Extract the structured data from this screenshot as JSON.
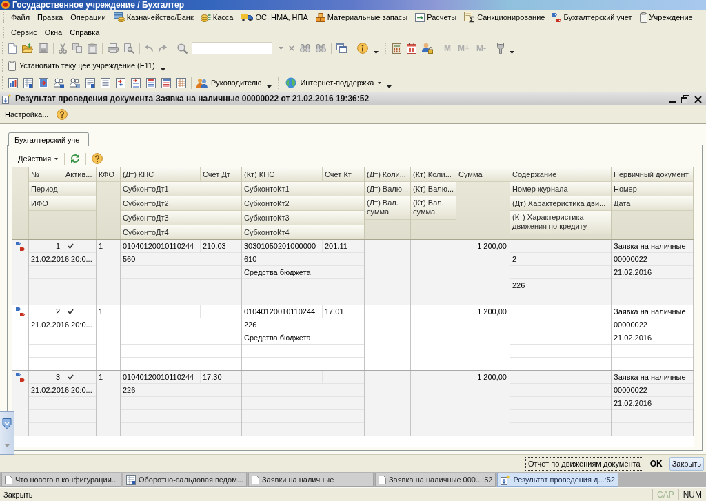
{
  "app_window": {
    "title": "Государственное учреждение / Бухгалтер"
  },
  "menu_bar": {
    "rows": [
      {
        "items": [
          {
            "label": "Файл"
          },
          {
            "label": "Правка"
          },
          {
            "label": "Операции"
          },
          {
            "label": "Казначейство/Банк"
          },
          {
            "label": "Касса"
          },
          {
            "label": "ОС, НМА, НПА"
          },
          {
            "label": "Материальные запасы"
          },
          {
            "label": "Расчеты"
          },
          {
            "label": "Санкционирование"
          },
          {
            "label": "Бухгалтерский учет"
          },
          {
            "label": "Учреждение"
          }
        ]
      },
      {
        "items": [
          {
            "label": "Сервис"
          },
          {
            "label": "Окна"
          },
          {
            "label": "Справка"
          }
        ]
      }
    ]
  },
  "main_toolbar": {
    "memory_buttons": [
      {
        "label": "M",
        "disabled": true
      },
      {
        "label": "M+",
        "disabled": true
      },
      {
        "label": "M-",
        "disabled": true
      }
    ]
  },
  "organization_toolbar": {
    "button": "Установить текущее учреждение (F11)"
  },
  "reports_toolbar": {
    "buttons": [
      {
        "label": "Руководителю"
      },
      {
        "label": "Интернет-поддержка"
      }
    ]
  },
  "document_window": {
    "title": "Результат проведения документа Заявка на наличные 00000022 от 21.02.2016 19:36:52",
    "settings": "Настройка...",
    "tabs": [
      {
        "label": "Бухгалтерский учет",
        "selected": true
      }
    ],
    "actions": "Действия",
    "table": {
      "header": {
        "number": "№",
        "active": "Актив...",
        "period": "Период",
        "ifo": "ИФО",
        "kfo": "КФО",
        "debit_kps": "(Дт) КПС",
        "debit_account": "Счет Дт",
        "debit_subconto": [
          "СубконтоДт1",
          "СубконтоДт2",
          "СубконтоДт3",
          "СубконтоДт4"
        ],
        "credit_kps": "(Кт) КПС",
        "credit_account": "Счет Кт",
        "credit_subconto": [
          "СубконтоКт1",
          "СубконтоКт2",
          "СубконтоКт3",
          "СубконтоКт4"
        ],
        "debit_quantity": "(Дт) Коли...",
        "debit_currency": "(Дт) Валю...",
        "debit_currency_amount": "(Дт) Вал. сумма",
        "credit_quantity": "(Кт) Коли...",
        "credit_currency": "(Кт) Валю...",
        "credit_currency_amount": "(Кт) Вал. сумма",
        "amount": "Сумма",
        "content": "Содержание",
        "journal": "Номер журнала",
        "debit_characteristic": "(Дт) Характеристика дви...",
        "credit_characteristic": "(Кт) Характеристика движения по кредиту",
        "document": "Первичный документ",
        "document_number": "Номер",
        "document_date": "Дата"
      },
      "rows": [
        {
          "number": "1",
          "active": true,
          "period": "21.02.2016 20:0...",
          "kfo": "1",
          "debit": {
            "kps": "01040120010110244",
            "account": "210.03",
            "subconto": [
              "560"
            ]
          },
          "credit": {
            "kps": "30301050201000000",
            "account": "201.11",
            "subconto": [
              "610",
              "Средства бюджета"
            ]
          },
          "amount": "1 200,00",
          "journal": "2",
          "credit_characteristic": "226",
          "document": "Заявка на наличные",
          "document_number": "00000022",
          "document_date": "21.02.2016"
        },
        {
          "number": "2",
          "active": true,
          "period": "21.02.2016 20:0...",
          "kfo": "1",
          "credit": {
            "kps": "01040120010110244",
            "account": "17.01",
            "subconto": [
              "226",
              "Средства бюджета"
            ]
          },
          "amount": "1 200,00",
          "document": "Заявка на наличные",
          "document_number": "00000022",
          "document_date": "21.02.2016"
        },
        {
          "number": "3",
          "active": true,
          "period": "21.02.2016 20:0...",
          "kfo": "1",
          "debit": {
            "kps": "01040120010110244",
            "account": "17.30",
            "subconto": [
              "226"
            ]
          },
          "amount": "1 200,00",
          "document": "Заявка на наличные",
          "document_number": "00000022",
          "document_date": "21.02.2016"
        }
      ]
    },
    "buttons": [
      {
        "label": "Отчет по движениям документа",
        "focused": true,
        "default": false,
        "highlighted": false
      },
      {
        "label": "OK",
        "focused": false,
        "default": true,
        "highlighted": false
      },
      {
        "label": "Закрыть",
        "focused": false,
        "default": false,
        "highlighted": true
      }
    ]
  },
  "taskbar": [
    {
      "label": "Что нового в конфигурации...",
      "selected": false
    },
    {
      "label": "Оборотно-сальдовая ведом...",
      "selected": false
    },
    {
      "label": "Заявки на наличные",
      "selected": false
    },
    {
      "label": "Заявка на наличные 000...:52",
      "selected": false
    },
    {
      "label": "Результат проведения д...:52",
      "selected": true
    }
  ],
  "status_bar": {
    "hint": "Закрыть",
    "indicators": [
      {
        "label": "CAP",
        "on": false
      },
      {
        "label": "NUM",
        "on": true
      }
    ]
  }
}
